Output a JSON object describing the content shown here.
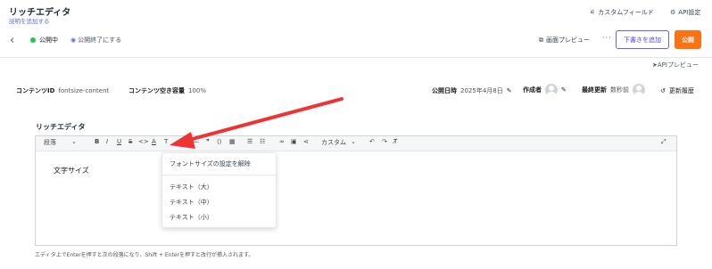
{
  "header": {
    "title": "リッチエディタ",
    "subtitle": "説明を追加する",
    "custom_field": "カスタムフィールド",
    "api_settings": "API設定"
  },
  "actionbar": {
    "status": "公開中",
    "end_publish": "公開終了にする",
    "preview": "画面プレビュー",
    "more": "···",
    "save_draft": "下書きを追加",
    "publish": "公開"
  },
  "api_preview": "APIプレビュー",
  "meta": {
    "content_id_label": "コンテンツID",
    "content_id_value": "fontsize-content",
    "capacity_label": "コンテンツ空き容量",
    "capacity_value": "100%",
    "published_label": "公開日時",
    "published_value": "2025年4月8日",
    "author_label": "作成者",
    "updated_label": "最終更新",
    "updated_value": "数秒前",
    "history": "更新履歴"
  },
  "field": {
    "label": "リッチエディタ",
    "content": "文字サイズ",
    "helper": "エディタ上でEnterを押すと次の段落になり、Shift + Enterを押すと改行が挿入されます。"
  },
  "toolbar": {
    "paragraph": "段落",
    "bold": "B",
    "italic": "I",
    "underline": "U",
    "strike": "S",
    "code": "<>",
    "color": "A",
    "fontsize": "T",
    "custom": "カスタム"
  },
  "dropdown": {
    "items": [
      "フォントサイズの設定を解除",
      "テキスト（大）",
      "テキスト（中）",
      "テキスト（小）"
    ]
  },
  "colors": {
    "accent": "#5b6ee8",
    "publish_button": "#f97316",
    "status_dot": "#22c55e",
    "arrow": "#ee3333"
  }
}
